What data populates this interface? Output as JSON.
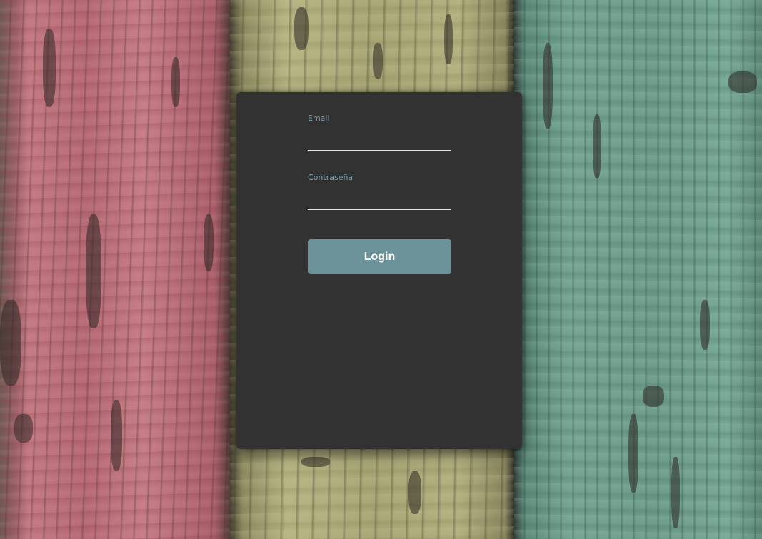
{
  "login_form": {
    "email_label": "Email",
    "email_value": "",
    "password_label": "Contraseña",
    "password_value": "",
    "submit_label": "Login"
  },
  "colors": {
    "card_background": "#323232",
    "label_color": "#7da3ab",
    "button_background": "#6b9299",
    "button_text": "#ffffff",
    "plank_red": "#b86a74",
    "plank_olive": "#a9a776",
    "plank_teal": "#6f9f8c"
  }
}
